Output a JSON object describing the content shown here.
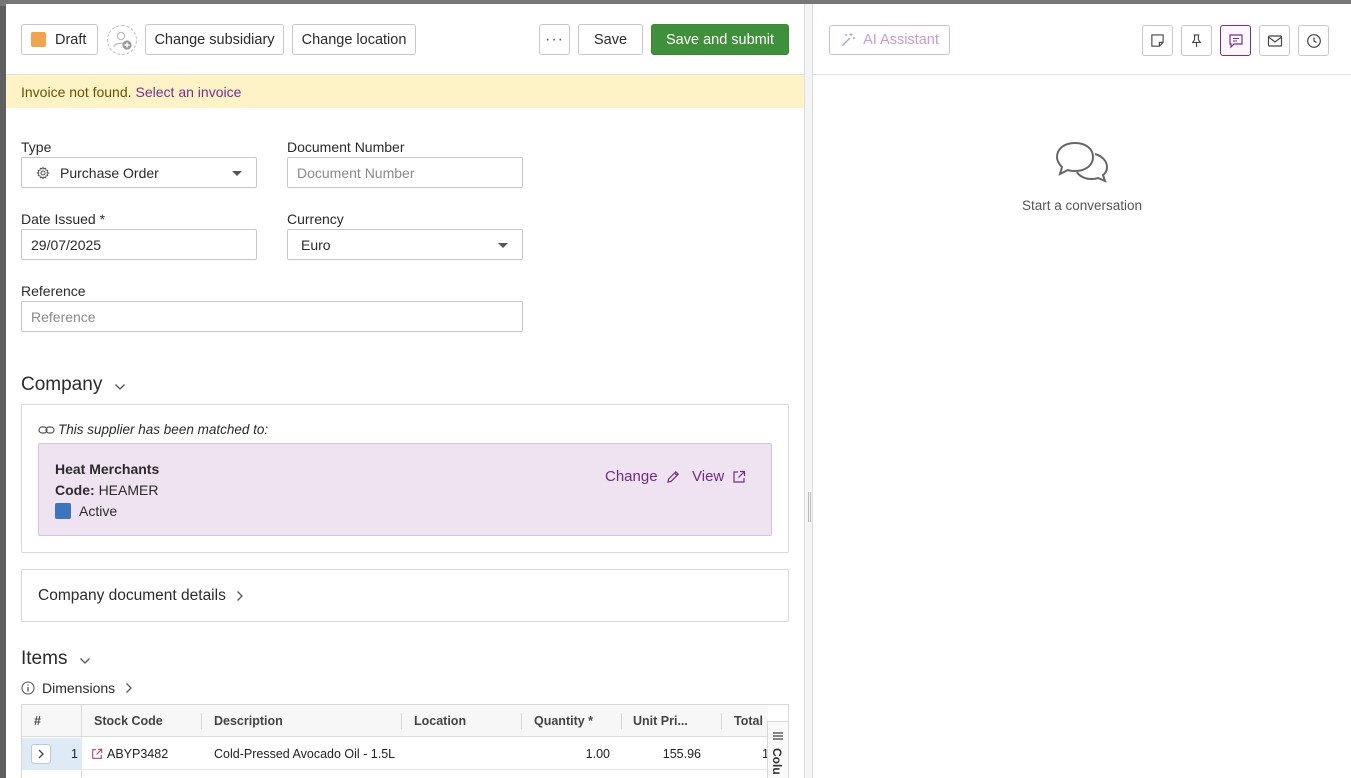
{
  "toolbar": {
    "status_label": "Draft",
    "status_color": "#f0a44f",
    "change_subsidiary": "Change subsidiary",
    "change_location": "Change location",
    "more_label": "···",
    "save": "Save",
    "save_and_submit": "Save and submit",
    "submit_color": "#3f8f3b"
  },
  "alert": {
    "message": "Invoice not found.",
    "link": "Select an invoice"
  },
  "form": {
    "type_label": "Type",
    "type_value": "Purchase Order",
    "document_number_label": "Document Number",
    "document_number_placeholder": "Document Number",
    "date_issued_label": "Date Issued *",
    "date_issued_value": "29/07/2025",
    "currency_label": "Currency",
    "currency_value": "Euro",
    "reference_label": "Reference",
    "reference_placeholder": "Reference"
  },
  "company": {
    "title": "Company",
    "matched_note": "This supplier has been matched to:",
    "supplier_name": "Heat Merchants",
    "code_label": "Code:",
    "code_value": "HEAMER",
    "status": "Active",
    "status_color": "#3b76ba",
    "change_link": "Change",
    "view_link": "View",
    "details_title": "Company document details"
  },
  "items": {
    "title": "Items",
    "dimensions": "Dimensions",
    "columns": [
      "#",
      "Stock Code",
      "Description",
      "Location",
      "Quantity *",
      "Unit Pri...",
      "Total"
    ],
    "rows": [
      {
        "index": "1",
        "stock_code": "ABYP3482",
        "description": "Cold-Pressed Avocado Oil - 1.5L",
        "location": "",
        "quantity": "1.00",
        "unit_price": "155.96",
        "total": "1"
      }
    ],
    "columns_panel_label": "Colu"
  },
  "sidebar": {
    "ai_assistant": "AI Assistant",
    "empty_state": "Start a conversation",
    "icons": [
      "note-icon",
      "pin-icon",
      "chat-icon",
      "mail-icon",
      "history-icon"
    ],
    "accent_color": "#7a2f8a"
  }
}
